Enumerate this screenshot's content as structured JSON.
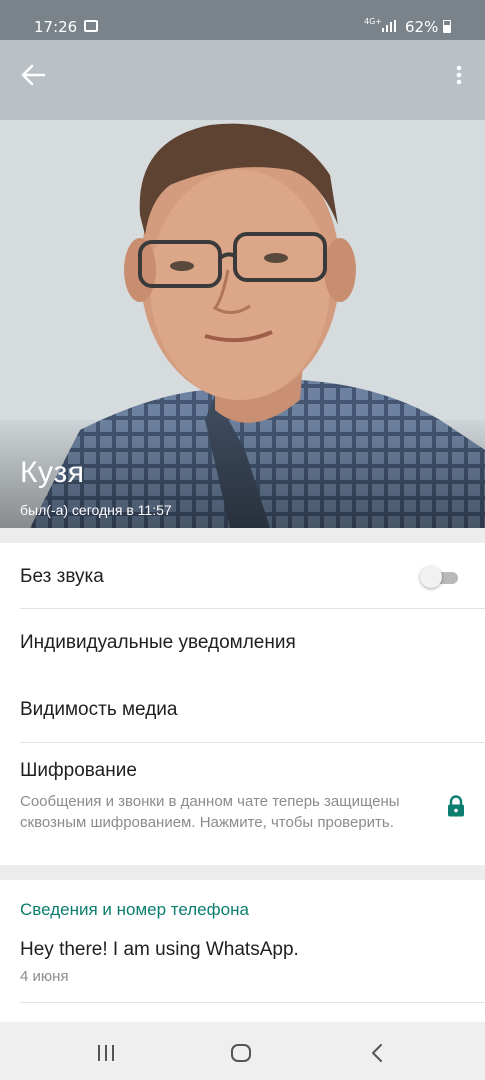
{
  "status_bar": {
    "time": "17:26",
    "network": "4G+",
    "battery": "62%"
  },
  "contact": {
    "name": "Кузя",
    "last_seen": "был(-а) сегодня в 11:57"
  },
  "settings": {
    "mute_label": "Без звука",
    "mute_enabled": false,
    "custom_notifications_label": "Индивидуальные уведомления",
    "media_visibility_label": "Видимость медиа",
    "encryption_label": "Шифрование",
    "encryption_description": "Сообщения и звонки в данном чате теперь защищены сквозным шифрованием. Нажмите, чтобы проверить."
  },
  "about": {
    "section_title": "Сведения и номер телефона",
    "status_text": "Hey there! I am using WhatsApp.",
    "status_date": "4 июня"
  },
  "colors": {
    "accent": "#0b7d6f",
    "lock": "#0b7d6f"
  }
}
